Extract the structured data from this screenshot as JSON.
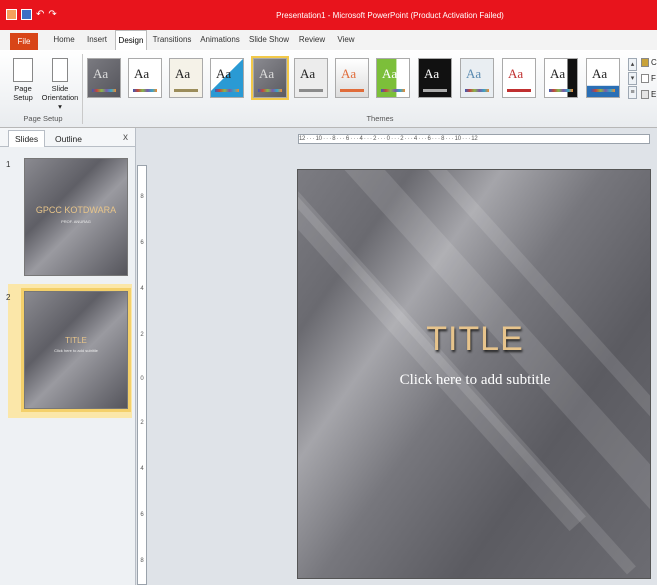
{
  "titlebar": {
    "title": "Presentation1 - Microsoft PowerPoint (Product Activation Failed)"
  },
  "tabs": [
    "File",
    "Home",
    "Insert",
    "Design",
    "Transitions",
    "Animations",
    "Slide Show",
    "Review",
    "View"
  ],
  "active_tab": "Design",
  "page_setup": {
    "page_setup_line1": "Page",
    "page_setup_line2": "Setup",
    "orientation_line1": "Slide",
    "orientation_line2": "Orientation ▾",
    "group_label": "Page Setup"
  },
  "themes": {
    "group_label": "Themes",
    "sample_text": "Aa"
  },
  "right_options": [
    "C",
    "F",
    "E"
  ],
  "left_pane": {
    "tab_slides": "Slides",
    "tab_outline": "Outline",
    "close": "x"
  },
  "slides": [
    {
      "number": "1",
      "title": "GPCC KOTDWARA",
      "subtitle": "PROF. ANURAG"
    },
    {
      "number": "2",
      "title": "TITLE",
      "subtitle": "Click here to add subtitle"
    }
  ],
  "ruler": {
    "horizontal": "12 · · · 10 · · · 8 · · · 6 · · · 4 · · · 2 · · · 0 · · · 2 · · · 4 · · · 6 · · · 8 · · · 10 · · · 12",
    "vertical": [
      "8",
      "6",
      "4",
      "2",
      "0",
      "2",
      "4",
      "6",
      "8"
    ]
  },
  "main_slide": {
    "title": "TITLE",
    "subtitle": "Click here to add subtitle"
  },
  "colors": {
    "titlebar": "#e8141c",
    "file_tab": "#d84518",
    "selection": "#f4d06a",
    "slide_title": "#e7c48c"
  }
}
